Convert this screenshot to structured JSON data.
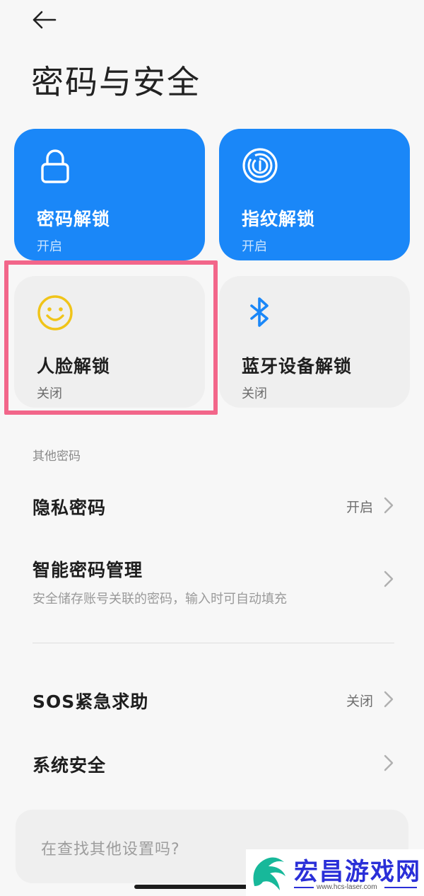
{
  "header": {
    "back_icon": "arrow-left-icon",
    "title": "密码与安全"
  },
  "unlock_tiles": [
    {
      "icon": "lock-icon",
      "label": "密码解锁",
      "status": "开启",
      "enabled": true
    },
    {
      "icon": "fingerprint-icon",
      "label": "指纹解锁",
      "status": "开启",
      "enabled": true
    },
    {
      "icon": "smiley-face-icon",
      "label": "人脸解锁",
      "status": "关闭",
      "enabled": false
    },
    {
      "icon": "bluetooth-icon",
      "label": "蓝牙设备解锁",
      "status": "关闭",
      "enabled": false
    }
  ],
  "other_passwords": {
    "header": "其他密码",
    "items": [
      {
        "label": "隐私密码",
        "value": "开启"
      },
      {
        "label": "智能密码管理",
        "subtitle": "安全储存账号关联的密码，输入时可自动填充"
      }
    ]
  },
  "more_settings": {
    "items": [
      {
        "label": "SOS紧急求助",
        "value": "关闭"
      },
      {
        "label": "系统安全"
      }
    ]
  },
  "search": {
    "placeholder": "在查找其他设置吗?"
  },
  "watermark": {
    "title": "宏昌游戏网",
    "url": "www.hcs-laser.com"
  },
  "colors": {
    "accent_blue": "#1a87f8",
    "tile_off_bg": "#efefef",
    "highlight_pink": "#f2668a",
    "smiley_yellow": "#f0c419",
    "bluetooth_blue": "#1a87f8",
    "watermark_blue": "#2a2fd8"
  }
}
